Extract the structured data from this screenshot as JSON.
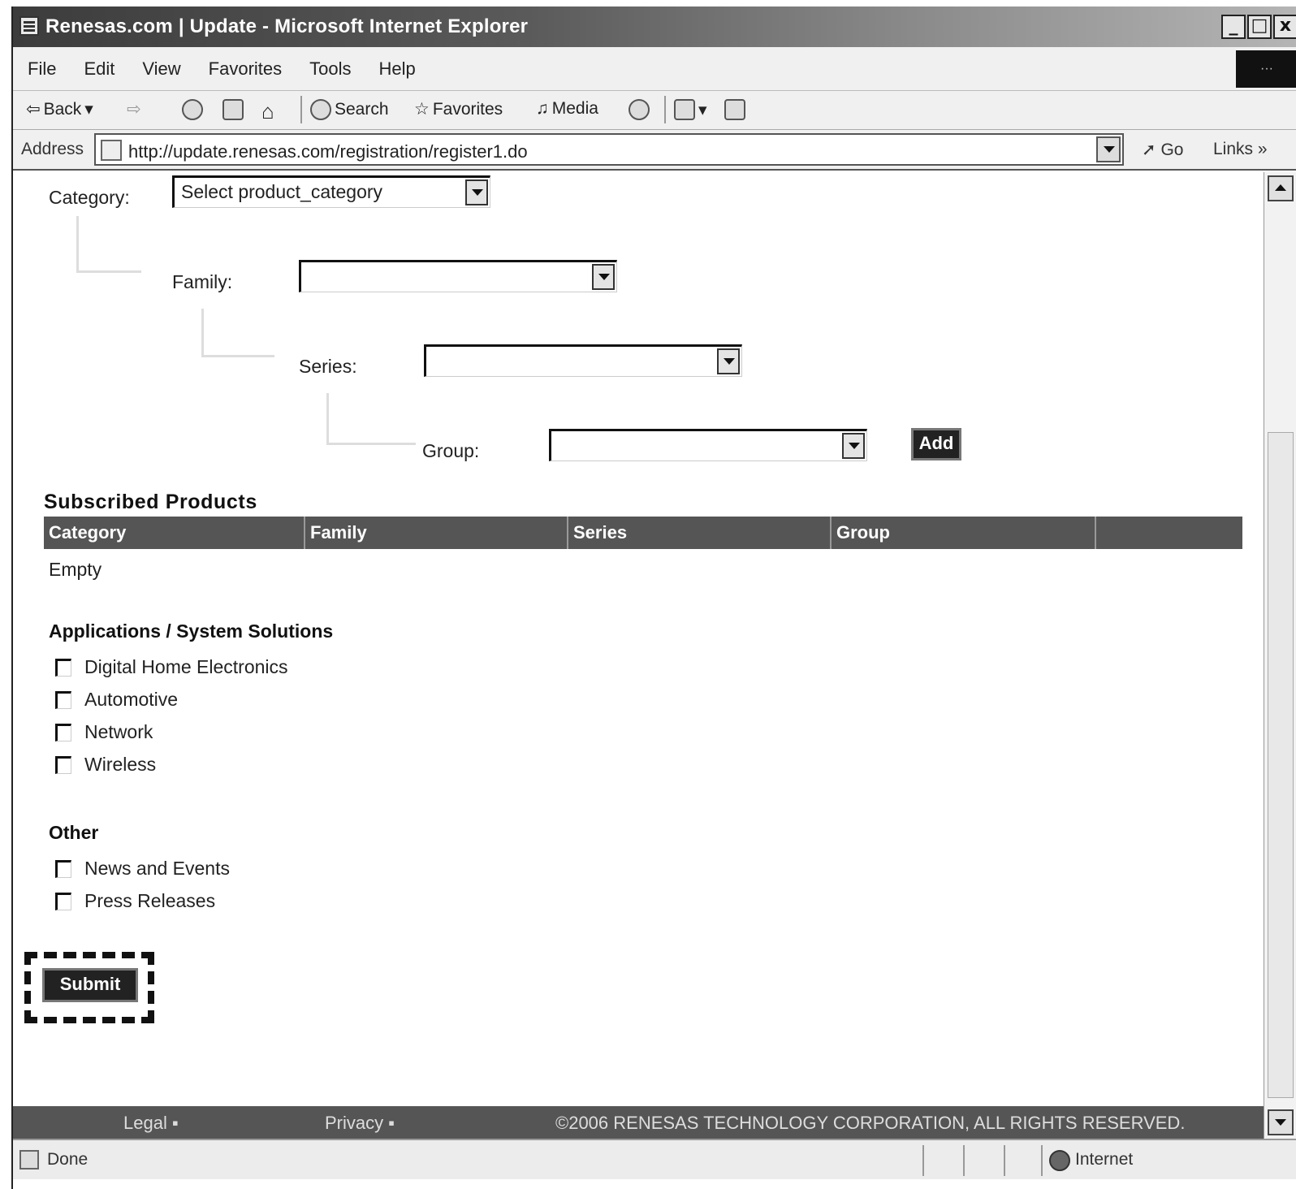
{
  "window": {
    "title": "Renesas.com | Update - Microsoft Internet Explorer",
    "buttons": [
      "_",
      "□",
      "x"
    ]
  },
  "menu": [
    "File",
    "Edit",
    "View",
    "Favorites",
    "Tools",
    "Help"
  ],
  "toolbar": {
    "back": "Back",
    "search": "Search",
    "favorites": "Favorites",
    "media": "Media"
  },
  "address": {
    "label": "Address",
    "url": "http://update.renesas.com/registration/register1.do",
    "go": "Go",
    "links": "Links »"
  },
  "form": {
    "category_label": "Category:",
    "category_value": "Select product_category",
    "family_label": "Family:",
    "family_value": "",
    "series_label": "Series:",
    "series_value": "",
    "group_label": "Group:",
    "group_value": "",
    "add_label": "Add"
  },
  "subscribed": {
    "title": "Subscribed Products",
    "columns": [
      "Category",
      "Family",
      "Series",
      "Group",
      ""
    ],
    "empty_text": "Empty"
  },
  "applications": {
    "title": "Applications / System Solutions",
    "items": [
      "Digital Home Electronics",
      "Automotive",
      "Network",
      "Wireless"
    ]
  },
  "other": {
    "title": "Other",
    "items": [
      "News and Events",
      "Press Releases"
    ]
  },
  "submit_label": "Submit",
  "footer": {
    "legal": "Legal ▪",
    "privacy": "Privacy ▪",
    "copyright": "©2006 RENESAS TECHNOLOGY CORPORATION, ALL RIGHTS RESERVED."
  },
  "status": {
    "text": "Done",
    "zone": "Internet"
  }
}
